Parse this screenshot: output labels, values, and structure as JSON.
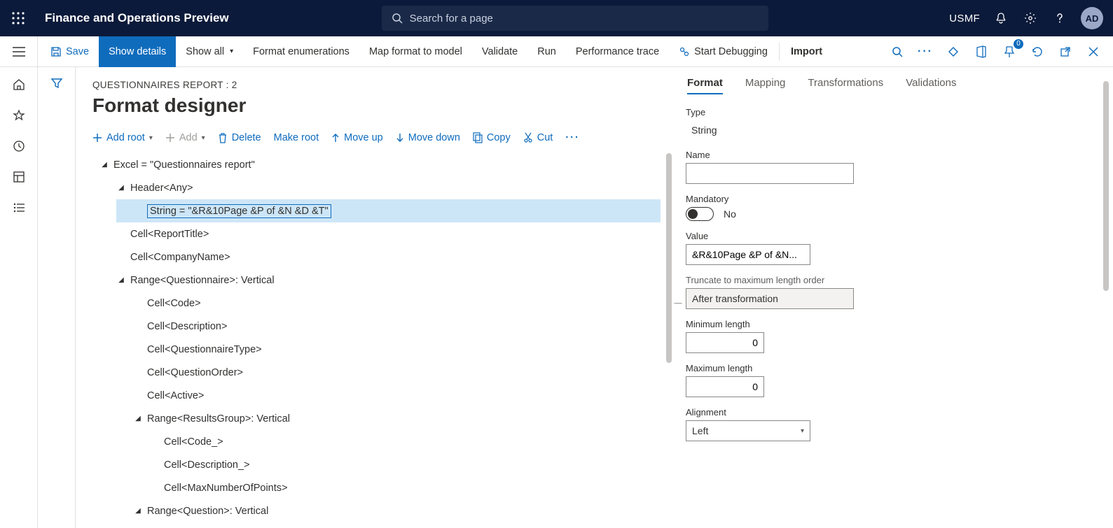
{
  "topbar": {
    "app_title": "Finance and Operations Preview",
    "search_placeholder": "Search for a page",
    "legal_entity": "USMF",
    "avatar": "AD"
  },
  "cmdbar": {
    "save": "Save",
    "show_details": "Show details",
    "show_all": "Show all",
    "format_enum": "Format enumerations",
    "map_format": "Map format to model",
    "validate": "Validate",
    "run": "Run",
    "perf_trace": "Performance trace",
    "start_debug": "Start Debugging",
    "import": "Import",
    "badge0": "0"
  },
  "page": {
    "breadcrumb": "QUESTIONNAIRES REPORT : 2",
    "title": "Format designer"
  },
  "tree_toolbar": {
    "add_root": "Add root",
    "add": "Add",
    "delete": "Delete",
    "make_root": "Make root",
    "move_up": "Move up",
    "move_down": "Move down",
    "copy": "Copy",
    "cut": "Cut"
  },
  "tree": [
    {
      "indent": 0,
      "caret": true,
      "label": "Excel = \"Questionnaires report\"",
      "sel": false
    },
    {
      "indent": 1,
      "caret": true,
      "label": "Header<Any>",
      "sel": false
    },
    {
      "indent": 2,
      "caret": false,
      "label": "String = \"&R&10Page &P of &N &D &T\"",
      "sel": true,
      "sel_indent": 1
    },
    {
      "indent": 1,
      "caret": false,
      "label": "Cell<ReportTitle>",
      "sel": false
    },
    {
      "indent": 1,
      "caret": false,
      "label": "Cell<CompanyName>",
      "sel": false
    },
    {
      "indent": 1,
      "caret": true,
      "label": "Range<Questionnaire>: Vertical",
      "sel": false
    },
    {
      "indent": 2,
      "caret": false,
      "label": "Cell<Code>",
      "sel": false
    },
    {
      "indent": 2,
      "caret": false,
      "label": "Cell<Description>",
      "sel": false
    },
    {
      "indent": 2,
      "caret": false,
      "label": "Cell<QuestionnaireType>",
      "sel": false
    },
    {
      "indent": 2,
      "caret": false,
      "label": "Cell<QuestionOrder>",
      "sel": false
    },
    {
      "indent": 2,
      "caret": false,
      "label": "Cell<Active>",
      "sel": false
    },
    {
      "indent": 2,
      "caret": true,
      "label": "Range<ResultsGroup>: Vertical",
      "sel": false
    },
    {
      "indent": 3,
      "caret": false,
      "label": "Cell<Code_>",
      "sel": false
    },
    {
      "indent": 3,
      "caret": false,
      "label": "Cell<Description_>",
      "sel": false
    },
    {
      "indent": 3,
      "caret": false,
      "label": "Cell<MaxNumberOfPoints>",
      "sel": false
    },
    {
      "indent": 2,
      "caret": true,
      "label": "Range<Question>: Vertical",
      "sel": false
    }
  ],
  "tabs": {
    "format": "Format",
    "mapping": "Mapping",
    "transformations": "Transformations",
    "validations": "Validations"
  },
  "props": {
    "type_label": "Type",
    "type_value": "String",
    "name_label": "Name",
    "name_value": "",
    "mandatory_label": "Mandatory",
    "mandatory_value": "No",
    "value_label": "Value",
    "value_value": "&R&10Page &P of &N...",
    "truncate_label": "Truncate to maximum length order",
    "truncate_value": "After transformation",
    "minlen_label": "Minimum length",
    "minlen_value": "0",
    "maxlen_label": "Maximum length",
    "maxlen_value": "0",
    "align_label": "Alignment",
    "align_value": "Left"
  }
}
